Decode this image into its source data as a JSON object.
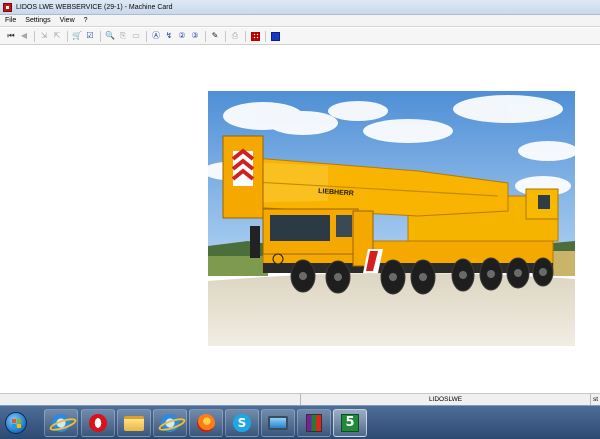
{
  "window": {
    "title": "LIDOS LWE WEBSERVICE (29-1) - Machine Card"
  },
  "menu": {
    "items": [
      "File",
      "Settings",
      "View",
      "?"
    ]
  },
  "toolbar": {
    "icons": [
      {
        "name": "first-record-icon",
        "glyph": "⏮"
      },
      {
        "name": "previous-record-icon",
        "glyph": "◀"
      },
      {
        "name": "import-icon",
        "glyph": "⇲"
      },
      {
        "name": "export-icon",
        "glyph": "⇱"
      },
      {
        "name": "cart-icon",
        "glyph": "🛒"
      },
      {
        "name": "checklist-icon",
        "glyph": "☑"
      },
      {
        "name": "zoom-icon",
        "glyph": "🔍"
      },
      {
        "name": "copy-icon",
        "glyph": "⎘"
      },
      {
        "name": "document-icon",
        "glyph": "▭"
      },
      {
        "name": "search-a-icon",
        "glyph": "Ⓐ"
      },
      {
        "name": "search-next-icon",
        "glyph": "↯"
      },
      {
        "name": "search-2-icon",
        "glyph": "②"
      },
      {
        "name": "search-3-icon",
        "glyph": "③"
      },
      {
        "name": "edit-icon",
        "glyph": "✎"
      },
      {
        "name": "print-icon",
        "glyph": "⎙"
      },
      {
        "name": "grid-icon",
        "glyph": ""
      },
      {
        "name": "blue-square-icon",
        "glyph": ""
      }
    ]
  },
  "photo": {
    "brand_text": "LIEBHERR",
    "colors": {
      "crane": "#f5a800",
      "sky": "#6fa8e0",
      "ground": "#e8e2d2"
    }
  },
  "statusbar": {
    "center": "LIDOSLWE",
    "right": "st"
  },
  "taskbar": {
    "apps": [
      {
        "name": "internet-explorer-icon"
      },
      {
        "name": "opera-icon"
      },
      {
        "name": "file-explorer-icon"
      },
      {
        "name": "internet-explorer-2-icon"
      },
      {
        "name": "firefox-icon"
      },
      {
        "name": "skype-icon"
      },
      {
        "name": "remote-desktop-icon"
      },
      {
        "name": "winrar-icon"
      },
      {
        "name": "app-5-icon",
        "label": "5"
      }
    ]
  }
}
